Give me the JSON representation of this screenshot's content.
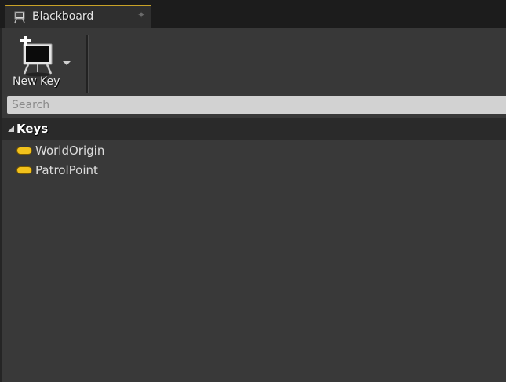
{
  "tab": {
    "label": "Blackboard",
    "icon": "blackboard-icon",
    "close_icon": "close-icon",
    "close_glyph": "✦",
    "accent_color": "#c9a227"
  },
  "toolbar": {
    "new_key_label": "New Key",
    "new_key_icon": "blackboard-add-icon",
    "dropdown_icon": "dropdown-arrow-icon"
  },
  "search": {
    "placeholder": "Search"
  },
  "keys_section": {
    "label": "Keys",
    "expanded": true
  },
  "keys": [
    {
      "name": "WorldOrigin",
      "color": "#f2c21c"
    },
    {
      "name": "PatrolPoint",
      "color": "#f2c21c"
    }
  ]
}
